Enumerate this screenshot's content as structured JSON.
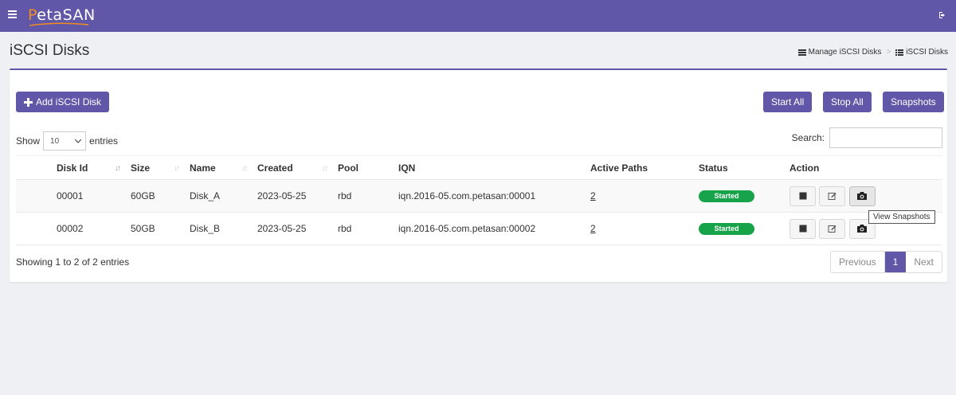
{
  "app": {
    "logo": "PetaSAN"
  },
  "page": {
    "title": "iSCSI Disks"
  },
  "breadcrumb": [
    {
      "label": "Manage iSCSI Disks"
    },
    {
      "label": "iSCSI Disks"
    }
  ],
  "toolbar": {
    "add_label": "Add iSCSI Disk",
    "start_all": "Start All",
    "stop_all": "Stop All",
    "snapshots": "Snapshots"
  },
  "length": {
    "show": "Show",
    "entries": "entries",
    "selected": "10"
  },
  "search": {
    "label": "Search:",
    "value": ""
  },
  "table": {
    "columns": [
      "Disk Id",
      "Size",
      "Name",
      "Created",
      "Pool",
      "IQN",
      "Active Paths",
      "Status",
      "Action"
    ],
    "rows": [
      {
        "disk_id": "00001",
        "size": "60GB",
        "name": "Disk_A",
        "created": "2023-05-25",
        "pool": "rbd",
        "iqn": "iqn.2016-05.com.petasan:00001",
        "paths": "2",
        "status": "Started"
      },
      {
        "disk_id": "00002",
        "size": "50GB",
        "name": "Disk_B",
        "created": "2023-05-25",
        "pool": "rbd",
        "iqn": "iqn.2016-05.com.petasan:00002",
        "paths": "2",
        "status": "Started"
      }
    ]
  },
  "tooltip": "View Snapshots",
  "footer": {
    "info": "Showing 1 to 2 of 2 entries",
    "prev": "Previous",
    "page": "1",
    "next": "Next"
  },
  "colors": {
    "brand": "#6057a8",
    "status_started": "#16a34a",
    "logo_accent": "#f28b22"
  },
  "icons": {
    "menu": "hamburger-icon",
    "logout": "logout-icon",
    "add": "plus-icon",
    "stop": "stop-icon",
    "edit": "edit-icon",
    "snapshot": "camera-icon",
    "sort": "sort-icon",
    "list": "list-icon"
  }
}
